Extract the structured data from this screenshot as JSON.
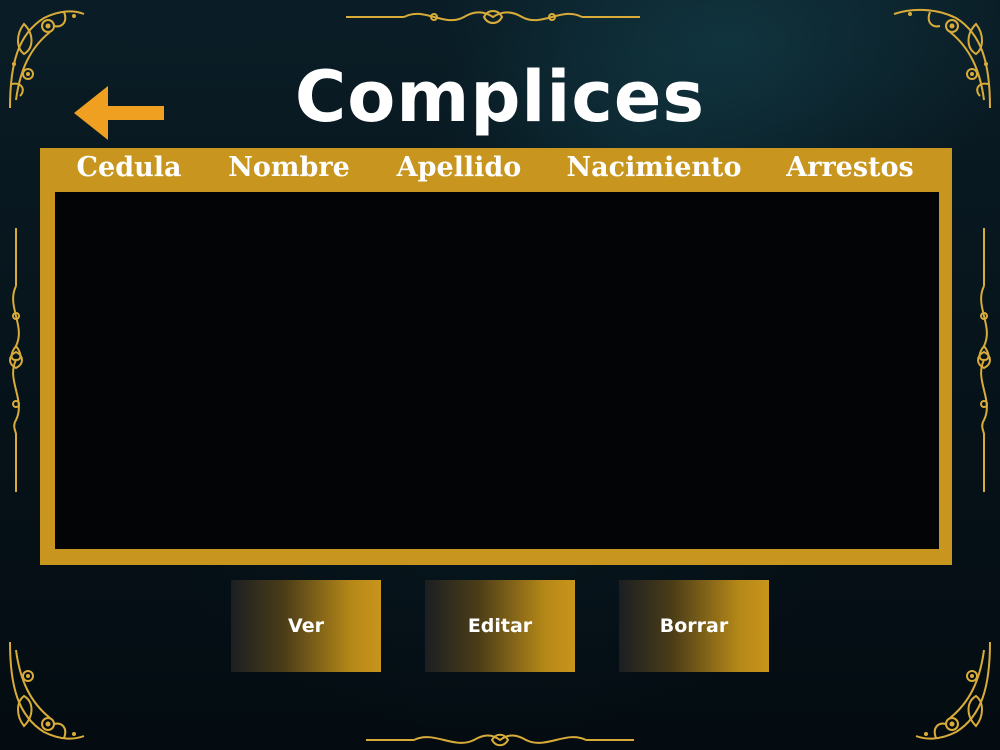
{
  "theme": {
    "accent": "#c8961e",
    "arrow": "#f0a020",
    "table_body": "#020406",
    "text": "#ffffff"
  },
  "header": {
    "back_icon": "arrow-left-icon",
    "title": "Complices"
  },
  "table": {
    "columns": [
      "Cedula",
      "Nombre",
      "Apellido",
      "Nacimiento",
      "Arrestos"
    ],
    "rows": []
  },
  "actions": {
    "view_label": "Ver",
    "edit_label": "Editar",
    "delete_label": "Borrar"
  },
  "decorations": {
    "corner_icon": "filigree-corner-icon",
    "divider_icon": "filigree-divider-icon",
    "side_icon": "filigree-side-icon"
  }
}
